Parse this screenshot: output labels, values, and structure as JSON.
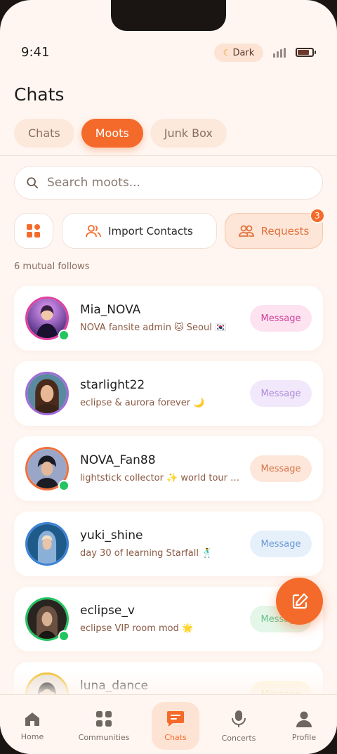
{
  "status": {
    "time": "9:41",
    "theme_toggle": "Dark",
    "theme_icon": "moon-icon"
  },
  "header": {
    "title": "Chats"
  },
  "tabs": [
    {
      "label": "Chats",
      "active": false
    },
    {
      "label": "Moots",
      "active": true
    },
    {
      "label": "Junk Box",
      "active": false
    }
  ],
  "search": {
    "placeholder": "Search moots..."
  },
  "actions": {
    "import_label": "Import Contacts",
    "requests_label": "Requests",
    "requests_count": "3"
  },
  "mutual_count": "6 mutual follows",
  "contacts": [
    {
      "name": "Mia_NOVA",
      "status": "NOVA fansite admin 🐱 Seoul 🇰🇷",
      "online": true,
      "message_label": "Message",
      "ring": "#e040a0",
      "btn_bg": "#fde2f0",
      "btn_fg": "#d0449a"
    },
    {
      "name": "starlight22",
      "status": "eclipse & aurora forever 🌙",
      "online": false,
      "message_label": "Message",
      "ring": "#a06ad8",
      "btn_bg": "#f1e8fb",
      "btn_fg": "#b08ad8"
    },
    {
      "name": "NOVA_Fan88",
      "status": "lightstick collector ✨ world tour ready",
      "online": true,
      "message_label": "Message",
      "ring": "#f0703a",
      "btn_bg": "#fde6da",
      "btn_fg": "#d6784c"
    },
    {
      "name": "yuki_shine",
      "status": "day 30 of learning Starfall 🕺",
      "online": false,
      "message_label": "Message",
      "ring": "#3b82d6",
      "btn_bg": "#e6f0fb",
      "btn_fg": "#6a9ad4"
    },
    {
      "name": "eclipse_v",
      "status": "eclipse VIP room mod 🌟",
      "online": true,
      "message_label": "Message",
      "ring": "#22c55e",
      "btn_bg": "#e3f6e8",
      "btn_fg": "#6ac28a"
    },
    {
      "name": "luna_dance",
      "status": "",
      "online": false,
      "message_label": "Message",
      "ring": "#f0c030",
      "btn_bg": "#fdf4d8",
      "btn_fg": "#d8b850"
    }
  ],
  "nav": [
    {
      "label": "Home",
      "icon": "home-icon"
    },
    {
      "label": "Communities",
      "icon": "grid-icon"
    },
    {
      "label": "Chats",
      "icon": "chat-icon",
      "active": true
    },
    {
      "label": "Concerts",
      "icon": "microphone-icon"
    },
    {
      "label": "Profile",
      "icon": "profile-icon"
    }
  ],
  "colors": {
    "accent": "#f46a2a",
    "background": "#fff6f1",
    "online": "#22c55e"
  }
}
